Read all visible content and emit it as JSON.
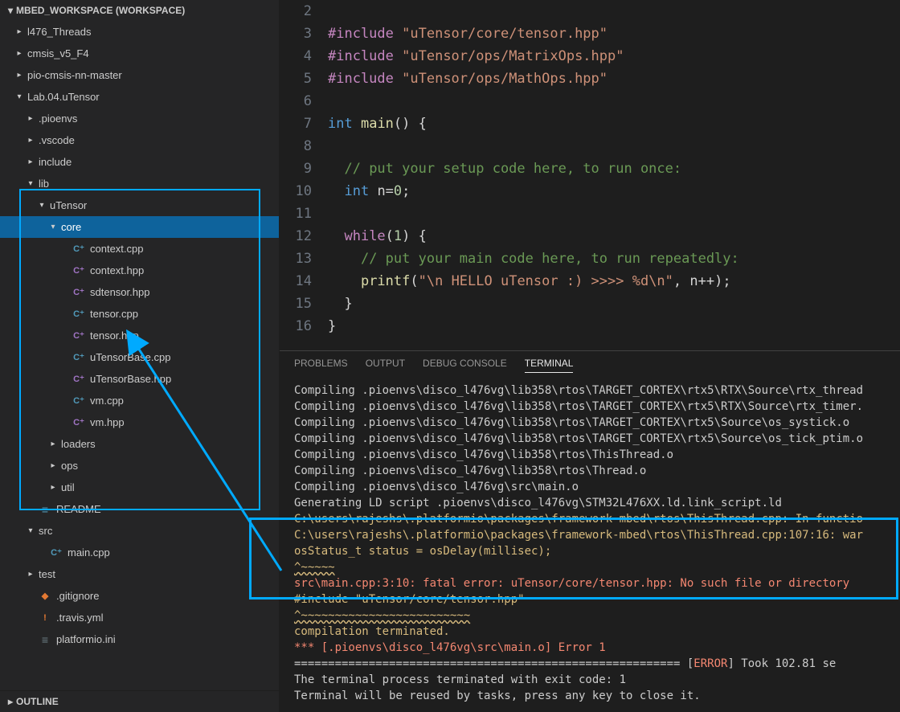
{
  "sidebar": {
    "header": "MBED_WORKSPACE (WORKSPACE)",
    "outline": "OUTLINE",
    "tree": [
      {
        "depth": 0,
        "twist": "▸",
        "label": "l476_Threads",
        "icon": "",
        "interact": true
      },
      {
        "depth": 0,
        "twist": "▸",
        "label": "cmsis_v5_F4",
        "icon": "",
        "interact": true
      },
      {
        "depth": 0,
        "twist": "▸",
        "label": "pio-cmsis-nn-master",
        "icon": "",
        "interact": true
      },
      {
        "depth": 0,
        "twist": "▾",
        "label": "Lab.04.uTensor",
        "icon": "",
        "interact": true
      },
      {
        "depth": 1,
        "twist": "▸",
        "label": ".pioenvs",
        "icon": "",
        "interact": true
      },
      {
        "depth": 1,
        "twist": "▸",
        "label": ".vscode",
        "icon": "",
        "interact": true
      },
      {
        "depth": 1,
        "twist": "▸",
        "label": "include",
        "icon": "",
        "interact": true
      },
      {
        "depth": 1,
        "twist": "▾",
        "label": "lib",
        "icon": "",
        "interact": true
      },
      {
        "depth": 2,
        "twist": "▾",
        "label": "uTensor",
        "icon": "",
        "interact": true
      },
      {
        "depth": 3,
        "twist": "▾",
        "label": "core",
        "icon": "",
        "interact": true,
        "selected": true
      },
      {
        "depth": 4,
        "twist": "",
        "label": "context.cpp",
        "icon": "cpp",
        "interact": true
      },
      {
        "depth": 4,
        "twist": "",
        "label": "context.hpp",
        "icon": "hpp",
        "interact": true
      },
      {
        "depth": 4,
        "twist": "",
        "label": "sdtensor.hpp",
        "icon": "hpp",
        "interact": true
      },
      {
        "depth": 4,
        "twist": "",
        "label": "tensor.cpp",
        "icon": "cpp",
        "interact": true
      },
      {
        "depth": 4,
        "twist": "",
        "label": "tensor.hpp",
        "icon": "hpp",
        "interact": true
      },
      {
        "depth": 4,
        "twist": "",
        "label": "uTensorBase.cpp",
        "icon": "cpp",
        "interact": true
      },
      {
        "depth": 4,
        "twist": "",
        "label": "uTensorBase.hpp",
        "icon": "hpp",
        "interact": true
      },
      {
        "depth": 4,
        "twist": "",
        "label": "vm.cpp",
        "icon": "cpp",
        "interact": true
      },
      {
        "depth": 4,
        "twist": "",
        "label": "vm.hpp",
        "icon": "hpp",
        "interact": true
      },
      {
        "depth": 3,
        "twist": "▸",
        "label": "loaders",
        "icon": "",
        "interact": true
      },
      {
        "depth": 3,
        "twist": "▸",
        "label": "ops",
        "icon": "",
        "interact": true
      },
      {
        "depth": 3,
        "twist": "▸",
        "label": "util",
        "icon": "",
        "interact": true
      },
      {
        "depth": 1,
        "twist": "",
        "label": "README",
        "icon": "readme",
        "interact": true
      },
      {
        "depth": 1,
        "twist": "▾",
        "label": "src",
        "icon": "",
        "interact": true
      },
      {
        "depth": 2,
        "twist": "",
        "label": "main.cpp",
        "icon": "cpp",
        "interact": true
      },
      {
        "depth": 1,
        "twist": "▸",
        "label": "test",
        "icon": "",
        "interact": true
      },
      {
        "depth": 1,
        "twist": "",
        "label": ".gitignore",
        "icon": "git",
        "interact": true
      },
      {
        "depth": 1,
        "twist": "",
        "label": ".travis.yml",
        "icon": "yml",
        "interact": true
      },
      {
        "depth": 1,
        "twist": "",
        "label": "platformio.ini",
        "icon": "ini",
        "interact": true
      }
    ]
  },
  "editor": {
    "lines": [
      {
        "n": 2,
        "tokens": []
      },
      {
        "n": 3,
        "tokens": [
          {
            "c": "tok-kw",
            "t": "#include"
          },
          {
            "c": "",
            "t": " "
          },
          {
            "c": "tok-str",
            "t": "\"uTensor/core/tensor.hpp\""
          }
        ]
      },
      {
        "n": 4,
        "tokens": [
          {
            "c": "tok-kw",
            "t": "#include"
          },
          {
            "c": "",
            "t": " "
          },
          {
            "c": "tok-str",
            "t": "\"uTensor/ops/MatrixOps.hpp\""
          }
        ]
      },
      {
        "n": 5,
        "tokens": [
          {
            "c": "tok-kw",
            "t": "#include"
          },
          {
            "c": "",
            "t": " "
          },
          {
            "c": "tok-str",
            "t": "\"uTensor/ops/MathOps.hpp\""
          }
        ]
      },
      {
        "n": 6,
        "tokens": []
      },
      {
        "n": 7,
        "tokens": [
          {
            "c": "tok-type",
            "t": "int"
          },
          {
            "c": "",
            "t": " "
          },
          {
            "c": "tok-func",
            "t": "main"
          },
          {
            "c": "tok-pun",
            "t": "() {"
          }
        ]
      },
      {
        "n": 8,
        "tokens": []
      },
      {
        "n": 9,
        "tokens": [
          {
            "c": "",
            "t": "  "
          },
          {
            "c": "tok-comment",
            "t": "// put your setup code here, to run once:"
          }
        ]
      },
      {
        "n": 10,
        "tokens": [
          {
            "c": "",
            "t": "  "
          },
          {
            "c": "tok-type",
            "t": "int"
          },
          {
            "c": "",
            "t": " n="
          },
          {
            "c": "tok-num",
            "t": "0"
          },
          {
            "c": "tok-pun",
            "t": ";"
          }
        ]
      },
      {
        "n": 11,
        "tokens": []
      },
      {
        "n": 12,
        "tokens": [
          {
            "c": "",
            "t": "  "
          },
          {
            "c": "tok-kw",
            "t": "while"
          },
          {
            "c": "tok-pun",
            "t": "("
          },
          {
            "c": "tok-num",
            "t": "1"
          },
          {
            "c": "tok-pun",
            "t": ") {"
          }
        ]
      },
      {
        "n": 13,
        "tokens": [
          {
            "c": "",
            "t": "    "
          },
          {
            "c": "tok-comment",
            "t": "// put your main code here, to run repeatedly:"
          }
        ]
      },
      {
        "n": 14,
        "tokens": [
          {
            "c": "",
            "t": "    "
          },
          {
            "c": "tok-func",
            "t": "printf"
          },
          {
            "c": "tok-pun",
            "t": "("
          },
          {
            "c": "tok-str",
            "t": "\"\\n HELLO uTensor :) >>>> %d\\n\""
          },
          {
            "c": "tok-pun",
            "t": ", n++);"
          }
        ]
      },
      {
        "n": 15,
        "tokens": [
          {
            "c": "",
            "t": "  "
          },
          {
            "c": "tok-pun",
            "t": "}"
          }
        ]
      },
      {
        "n": 16,
        "tokens": [
          {
            "c": "tok-pun",
            "t": "}"
          }
        ]
      }
    ]
  },
  "panel": {
    "tabs": [
      {
        "label": "PROBLEMS",
        "active": false
      },
      {
        "label": "OUTPUT",
        "active": false
      },
      {
        "label": "DEBUG CONSOLE",
        "active": false
      },
      {
        "label": "TERMINAL",
        "active": true
      }
    ],
    "terminal": [
      {
        "c": "",
        "t": "Compiling .pioenvs\\disco_l476vg\\lib358\\rtos\\TARGET_CORTEX\\rtx5\\RTX\\Source\\rtx_thread"
      },
      {
        "c": "",
        "t": "Compiling .pioenvs\\disco_l476vg\\lib358\\rtos\\TARGET_CORTEX\\rtx5\\RTX\\Source\\rtx_timer."
      },
      {
        "c": "",
        "t": "Compiling .pioenvs\\disco_l476vg\\lib358\\rtos\\TARGET_CORTEX\\rtx5\\Source\\os_systick.o"
      },
      {
        "c": "",
        "t": "Compiling .pioenvs\\disco_l476vg\\lib358\\rtos\\TARGET_CORTEX\\rtx5\\Source\\os_tick_ptim.o"
      },
      {
        "c": "",
        "t": "Compiling .pioenvs\\disco_l476vg\\lib358\\rtos\\ThisThread.o"
      },
      {
        "c": "",
        "t": "Compiling .pioenvs\\disco_l476vg\\lib358\\rtos\\Thread.o"
      },
      {
        "c": "",
        "t": "Compiling .pioenvs\\disco_l476vg\\src\\main.o"
      },
      {
        "c": "",
        "t": "Generating LD script .pioenvs\\disco_l476vg\\STM32L476XX.ld.link_script.ld"
      },
      {
        "c": "t-yel",
        "t": "C:\\users\\rajeshs\\.platformio\\packages\\framework-mbed\\rtos\\ThisThread.cpp: In functio"
      },
      {
        "c": "t-yel",
        "t": "C:\\users\\rajeshs\\.platformio\\packages\\framework-mbed\\rtos\\ThisThread.cpp:107:16: war"
      },
      {
        "c": "t-yel",
        "t": "osStatus_t status = osDelay(millisec);"
      },
      {
        "c": "t-wavy",
        "t": "^~~~~~"
      },
      {
        "c": "t-red",
        "t": "src\\main.cpp:3:10: fatal error: uTensor/core/tensor.hpp: No such file or directory"
      },
      {
        "c": "t-yel",
        "t": "#include \"uTensor/core/tensor.hpp\""
      },
      {
        "c": "t-wavy",
        "t": "^~~~~~~~~~~~~~~~~~~~~~~~~~"
      },
      {
        "c": "t-yel",
        "t": "compilation terminated."
      },
      {
        "c": "t-red",
        "t": "*** [.pioenvs\\disco_l476vg\\src\\main.o] Error 1"
      },
      {
        "c": "",
        "t": "========================================================= [ERROR] Took 102.81 se",
        "err": true
      },
      {
        "c": "",
        "t": "The terminal process terminated with exit code: 1"
      },
      {
        "c": "",
        "t": ""
      },
      {
        "c": "",
        "t": "Terminal will be reused by tasks, press any key to close it."
      }
    ]
  }
}
